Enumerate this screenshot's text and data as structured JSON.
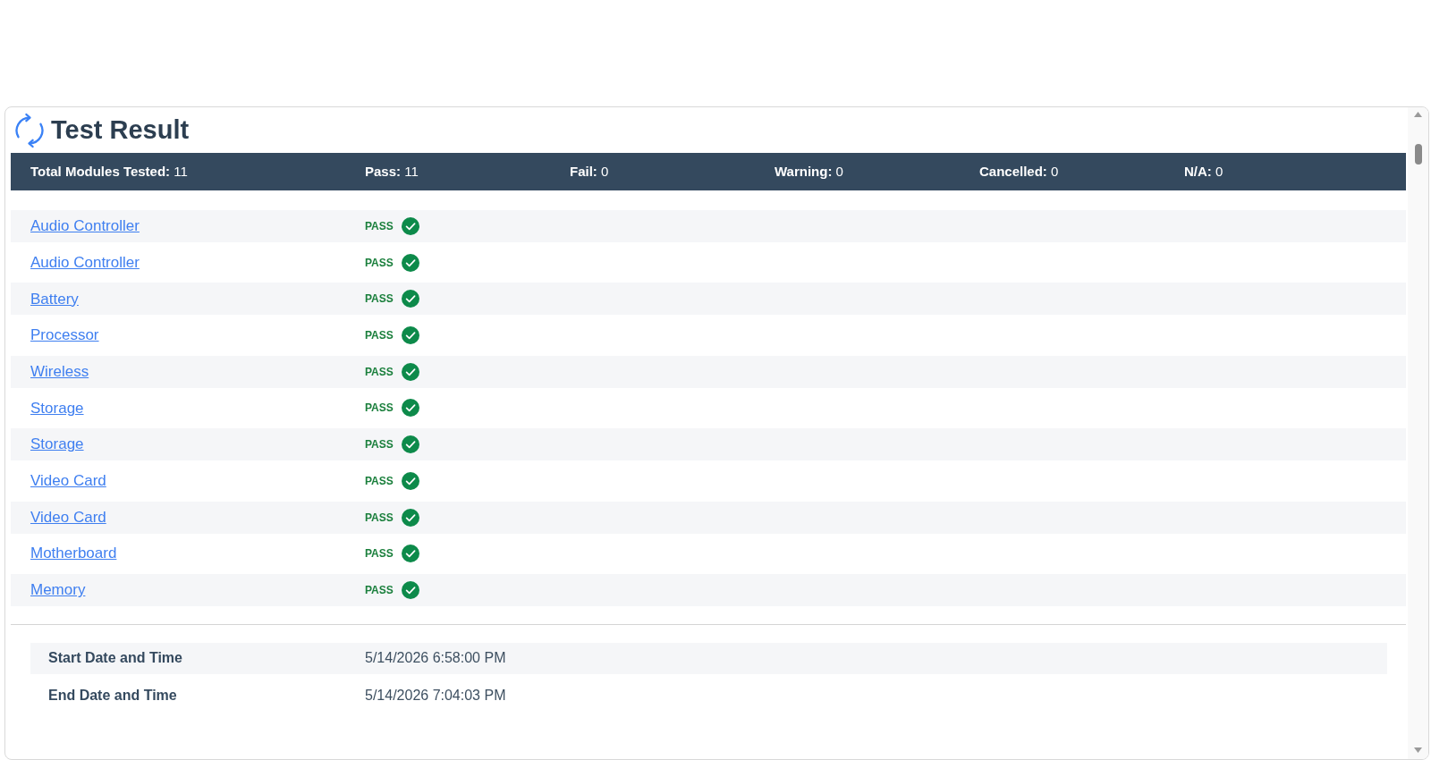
{
  "header": {
    "title": "Test Result"
  },
  "summary": [
    {
      "label": "Total Modules Tested:",
      "value": "11"
    },
    {
      "label": "Pass:",
      "value": "11"
    },
    {
      "label": "Fail:",
      "value": "0"
    },
    {
      "label": "Warning:",
      "value": "0"
    },
    {
      "label": "Cancelled:",
      "value": "0"
    },
    {
      "label": "N/A:",
      "value": "0"
    }
  ],
  "modules": [
    {
      "name": "Audio Controller",
      "result": "PASS",
      "kind": "pass"
    },
    {
      "name": "Audio Controller",
      "result": "PASS",
      "kind": "pass"
    },
    {
      "name": "Battery",
      "result": "PASS",
      "kind": "pass"
    },
    {
      "name": "Processor",
      "result": "PASS",
      "kind": "pass"
    },
    {
      "name": "Wireless",
      "result": "PASS",
      "kind": "pass"
    },
    {
      "name": "Storage",
      "result": "PASS",
      "kind": "pass"
    },
    {
      "name": "Storage",
      "result": "PASS",
      "kind": "pass"
    },
    {
      "name": "Video Card",
      "result": "PASS",
      "kind": "pass"
    },
    {
      "name": "Video Card",
      "result": "PASS",
      "kind": "pass"
    },
    {
      "name": "Motherboard",
      "result": "PASS",
      "kind": "pass"
    },
    {
      "name": "Memory",
      "result": "PASS",
      "kind": "pass"
    }
  ],
  "times": [
    {
      "label": "Start Date and Time",
      "value": "5/14/2026 6:58:00 PM"
    },
    {
      "label": "End Date and Time",
      "value": "5/14/2026 7:04:03 PM"
    }
  ]
}
